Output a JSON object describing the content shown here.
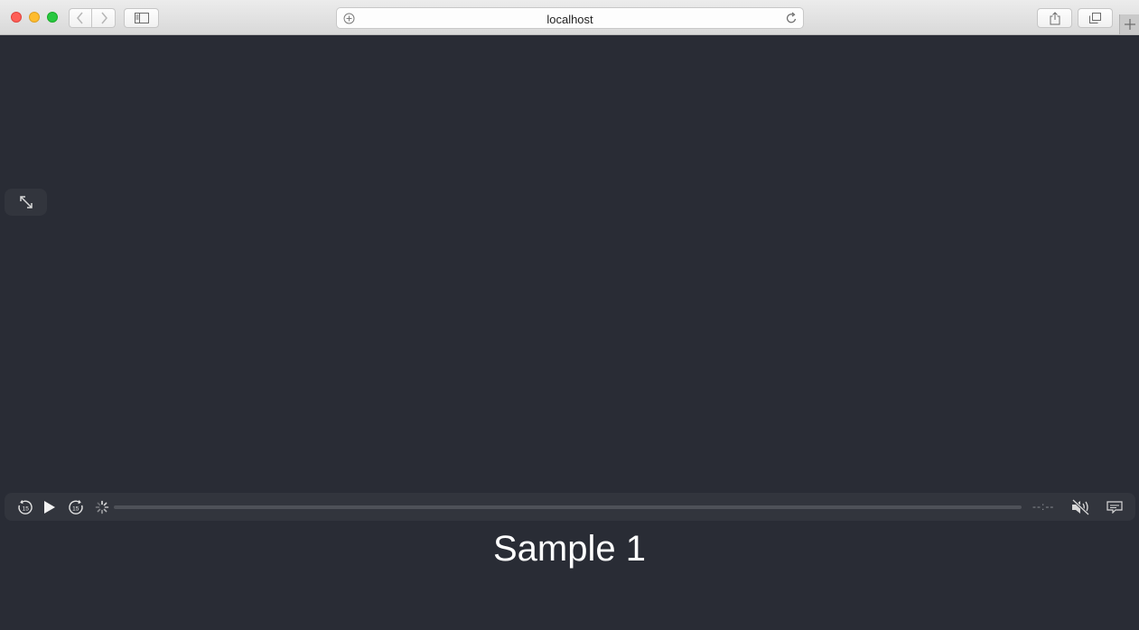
{
  "browser": {
    "url": "localhost",
    "icons": {
      "back": "chevron-left-icon",
      "forward": "chevron-right-icon",
      "sidebar": "sidebar-icon",
      "add": "plus-circle-icon",
      "reload": "reload-icon",
      "share": "share-icon",
      "tabs": "tabs-overview-icon",
      "new_tab": "plus-icon"
    }
  },
  "player": {
    "skip_back_seconds": "15",
    "skip_forward_seconds": "15",
    "time_display": "--:--",
    "icons": {
      "fullscreen": "fullscreen-expand-icon",
      "play": "play-icon",
      "spinner": "loading-spinner-icon",
      "mute": "muted-speaker-icon",
      "captions": "captions-icon"
    }
  },
  "page": {
    "title": "Sample 1"
  },
  "colors": {
    "background": "#292c35",
    "control_bar": "#32353d",
    "title_text": "#ffffff"
  }
}
